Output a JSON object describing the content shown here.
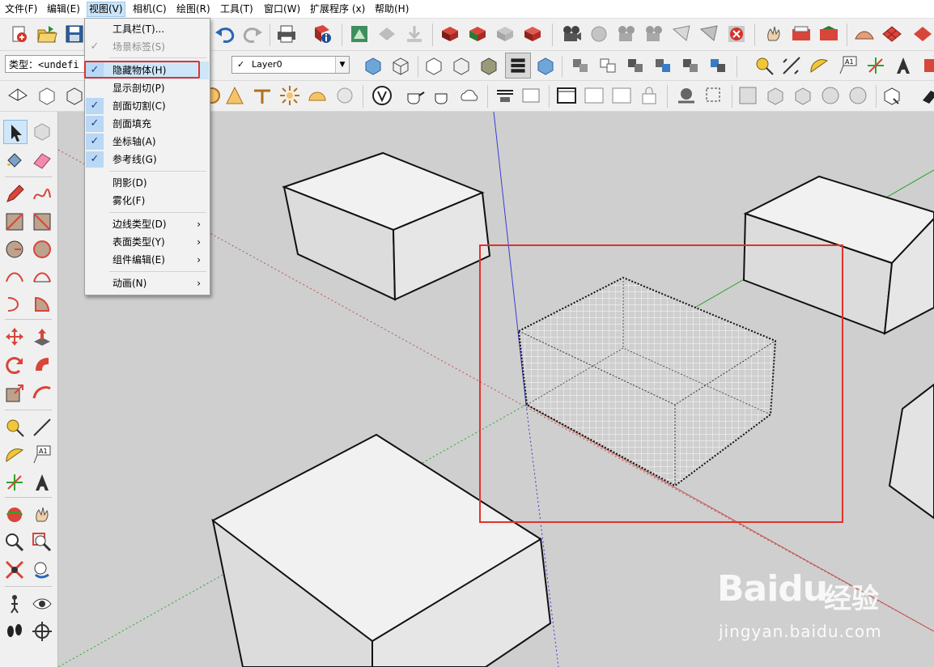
{
  "menubar": {
    "items": [
      "文件(F)",
      "编辑(E)",
      "视图(V)",
      "相机(C)",
      "绘图(R)",
      "工具(T)",
      "窗口(W)",
      "扩展程序 (x)",
      "帮助(H)"
    ]
  },
  "entity_info": {
    "type_label": "类型：<undefi"
  },
  "layer": {
    "name": "Layer0"
  },
  "view_menu": {
    "items": [
      {
        "label": "工具栏(T)...",
        "checked": false
      },
      {
        "label": "场景标签(S)",
        "checked": false
      },
      {
        "label": "隐藏物体(H)",
        "checked": true
      },
      {
        "label": "显示剖切(P)",
        "checked": false
      },
      {
        "label": "剖面切割(C)",
        "checked": true
      },
      {
        "label": "剖面填充",
        "checked": true
      },
      {
        "label": "坐标轴(A)",
        "checked": true
      },
      {
        "label": "参考线(G)",
        "checked": true
      },
      {
        "label": "阴影(D)",
        "checked": false
      },
      {
        "label": "雾化(F)",
        "checked": false
      },
      {
        "label": "边线类型(D)",
        "submenu": true
      },
      {
        "label": "表面类型(Y)",
        "submenu": true
      },
      {
        "label": "组件编辑(E)",
        "submenu": true
      },
      {
        "label": "动画(N)",
        "submenu": true
      }
    ]
  },
  "watermark": {
    "logo": "Baidu",
    "cn": "经验",
    "url": "jingyan.baidu.com"
  },
  "colors": {
    "highlight_red": "#e0332b",
    "menu_highlight": "#cde6f8",
    "axis_red": "#c0504d",
    "axis_green": "#2aa52a",
    "axis_blue": "#3b3bd1"
  }
}
